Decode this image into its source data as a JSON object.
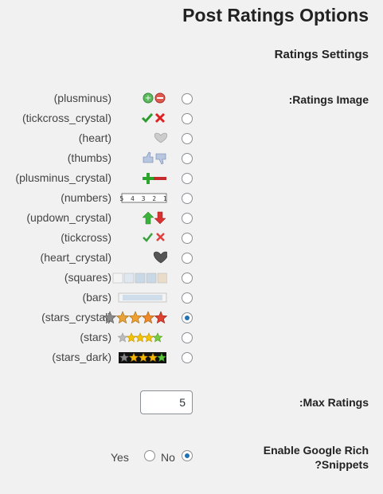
{
  "header": {
    "title": "Post Ratings Options"
  },
  "section": {
    "title": "Ratings Settings"
  },
  "ratings_image": {
    "label": ":Ratings Image",
    "selected": "stars_crystal",
    "options": [
      {
        "label": "(plusminus)",
        "icon": "plusminus-icon"
      },
      {
        "label": "(tickcross_crystal)",
        "icon": "tickcross-crystal-icon"
      },
      {
        "label": "(heart)",
        "icon": "heart-icon"
      },
      {
        "label": "(thumbs)",
        "icon": "thumbs-icon"
      },
      {
        "label": "(plusminus_crystal)",
        "icon": "plusminus-crystal-icon"
      },
      {
        "label": "(numbers)",
        "icon": "numbers-icon"
      },
      {
        "label": "(updown_crystal)",
        "icon": "updown-crystal-icon"
      },
      {
        "label": "(tickcross)",
        "icon": "tickcross-icon"
      },
      {
        "label": "(heart_crystal)",
        "icon": "heart-crystal-icon"
      },
      {
        "label": "(squares)",
        "icon": "squares-icon"
      },
      {
        "label": "(bars)",
        "icon": "bars-icon"
      },
      {
        "label": "(stars_crystal)",
        "icon": "stars-crystal-icon"
      },
      {
        "label": "(stars)",
        "icon": "stars-icon"
      },
      {
        "label": "(stars_dark)",
        "icon": "stars-dark-icon"
      }
    ],
    "numbers_glyphs": "5 4 3 2 1"
  },
  "max_ratings": {
    "label": ":Max Ratings",
    "value": "5"
  },
  "rich_snippets": {
    "label_line1": "Enable Google Rich",
    "label_line2": "?Snippets",
    "yes_label": "Yes",
    "no_label": "No",
    "selected": "yes"
  },
  "colors": {
    "accent": "#2271b1",
    "background": "#f1f1f1"
  }
}
